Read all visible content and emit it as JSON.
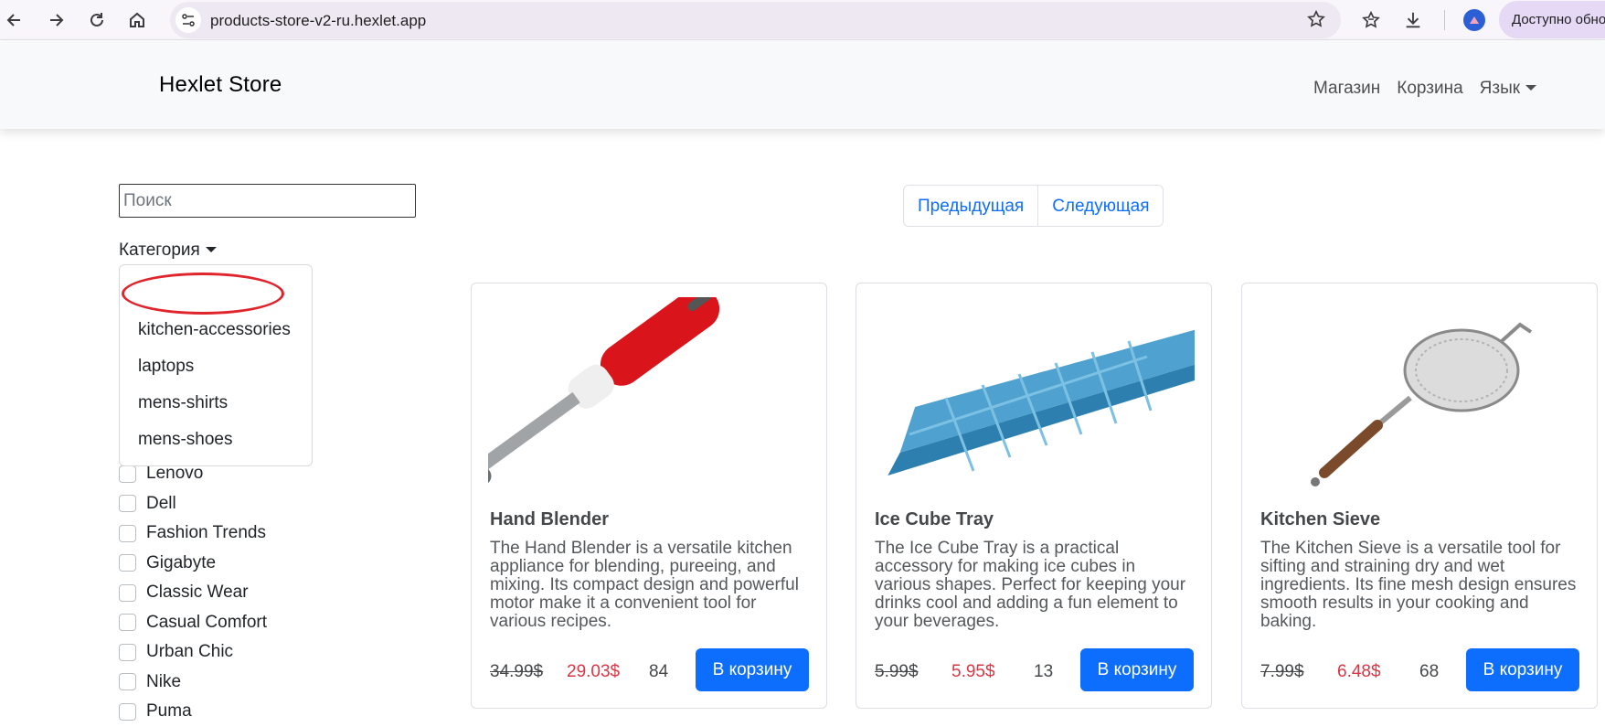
{
  "browser": {
    "url": "products-store-v2-ru.hexlet.app",
    "update_label": "Доступно обно"
  },
  "navbar": {
    "brand": "Hexlet Store",
    "links": [
      "Магазин",
      "Корзина",
      "Язык"
    ]
  },
  "sidebar": {
    "search_placeholder": "Поиск",
    "category_label": "Категория",
    "category_options": [
      "",
      "kitchen-accessories",
      "laptops",
      "mens-shirts",
      "mens-shoes"
    ],
    "brands": [
      "Lenovo",
      "Dell",
      "Fashion Trends",
      "Gigabyte",
      "Classic Wear",
      "Casual Comfort",
      "Urban Chic",
      "Nike",
      "Puma"
    ]
  },
  "pagination": {
    "prev": "Предыдущая",
    "next": "Следующая"
  },
  "products": [
    {
      "title": "Hand Blender",
      "description": "The Hand Blender is a versatile kitchen appliance for blending, pureeing, and mixing. Its compact design and powerful motor make it a convenient tool for various recipes.",
      "old_price": "34.99$",
      "price": "29.03$",
      "stock": "84",
      "button": "В корзину"
    },
    {
      "title": "Ice Cube Tray",
      "description": "The Ice Cube Tray is a practical accessory for making ice cubes in various shapes. Perfect for keeping your drinks cool and adding a fun element to your beverages.",
      "old_price": "5.99$",
      "price": "5.95$",
      "stock": "13",
      "button": "В корзину"
    },
    {
      "title": "Kitchen Sieve",
      "description": "The Kitchen Sieve is a versatile tool for sifting and straining dry and wet ingredients. Its fine mesh design ensures smooth results in your cooking and baking.",
      "old_price": "7.99$",
      "price": "6.48$",
      "stock": "68",
      "button": "В корзину"
    }
  ],
  "colors": {
    "accent": "#0d6efd",
    "sale": "#dc3545",
    "highlight": "#e0242c"
  }
}
